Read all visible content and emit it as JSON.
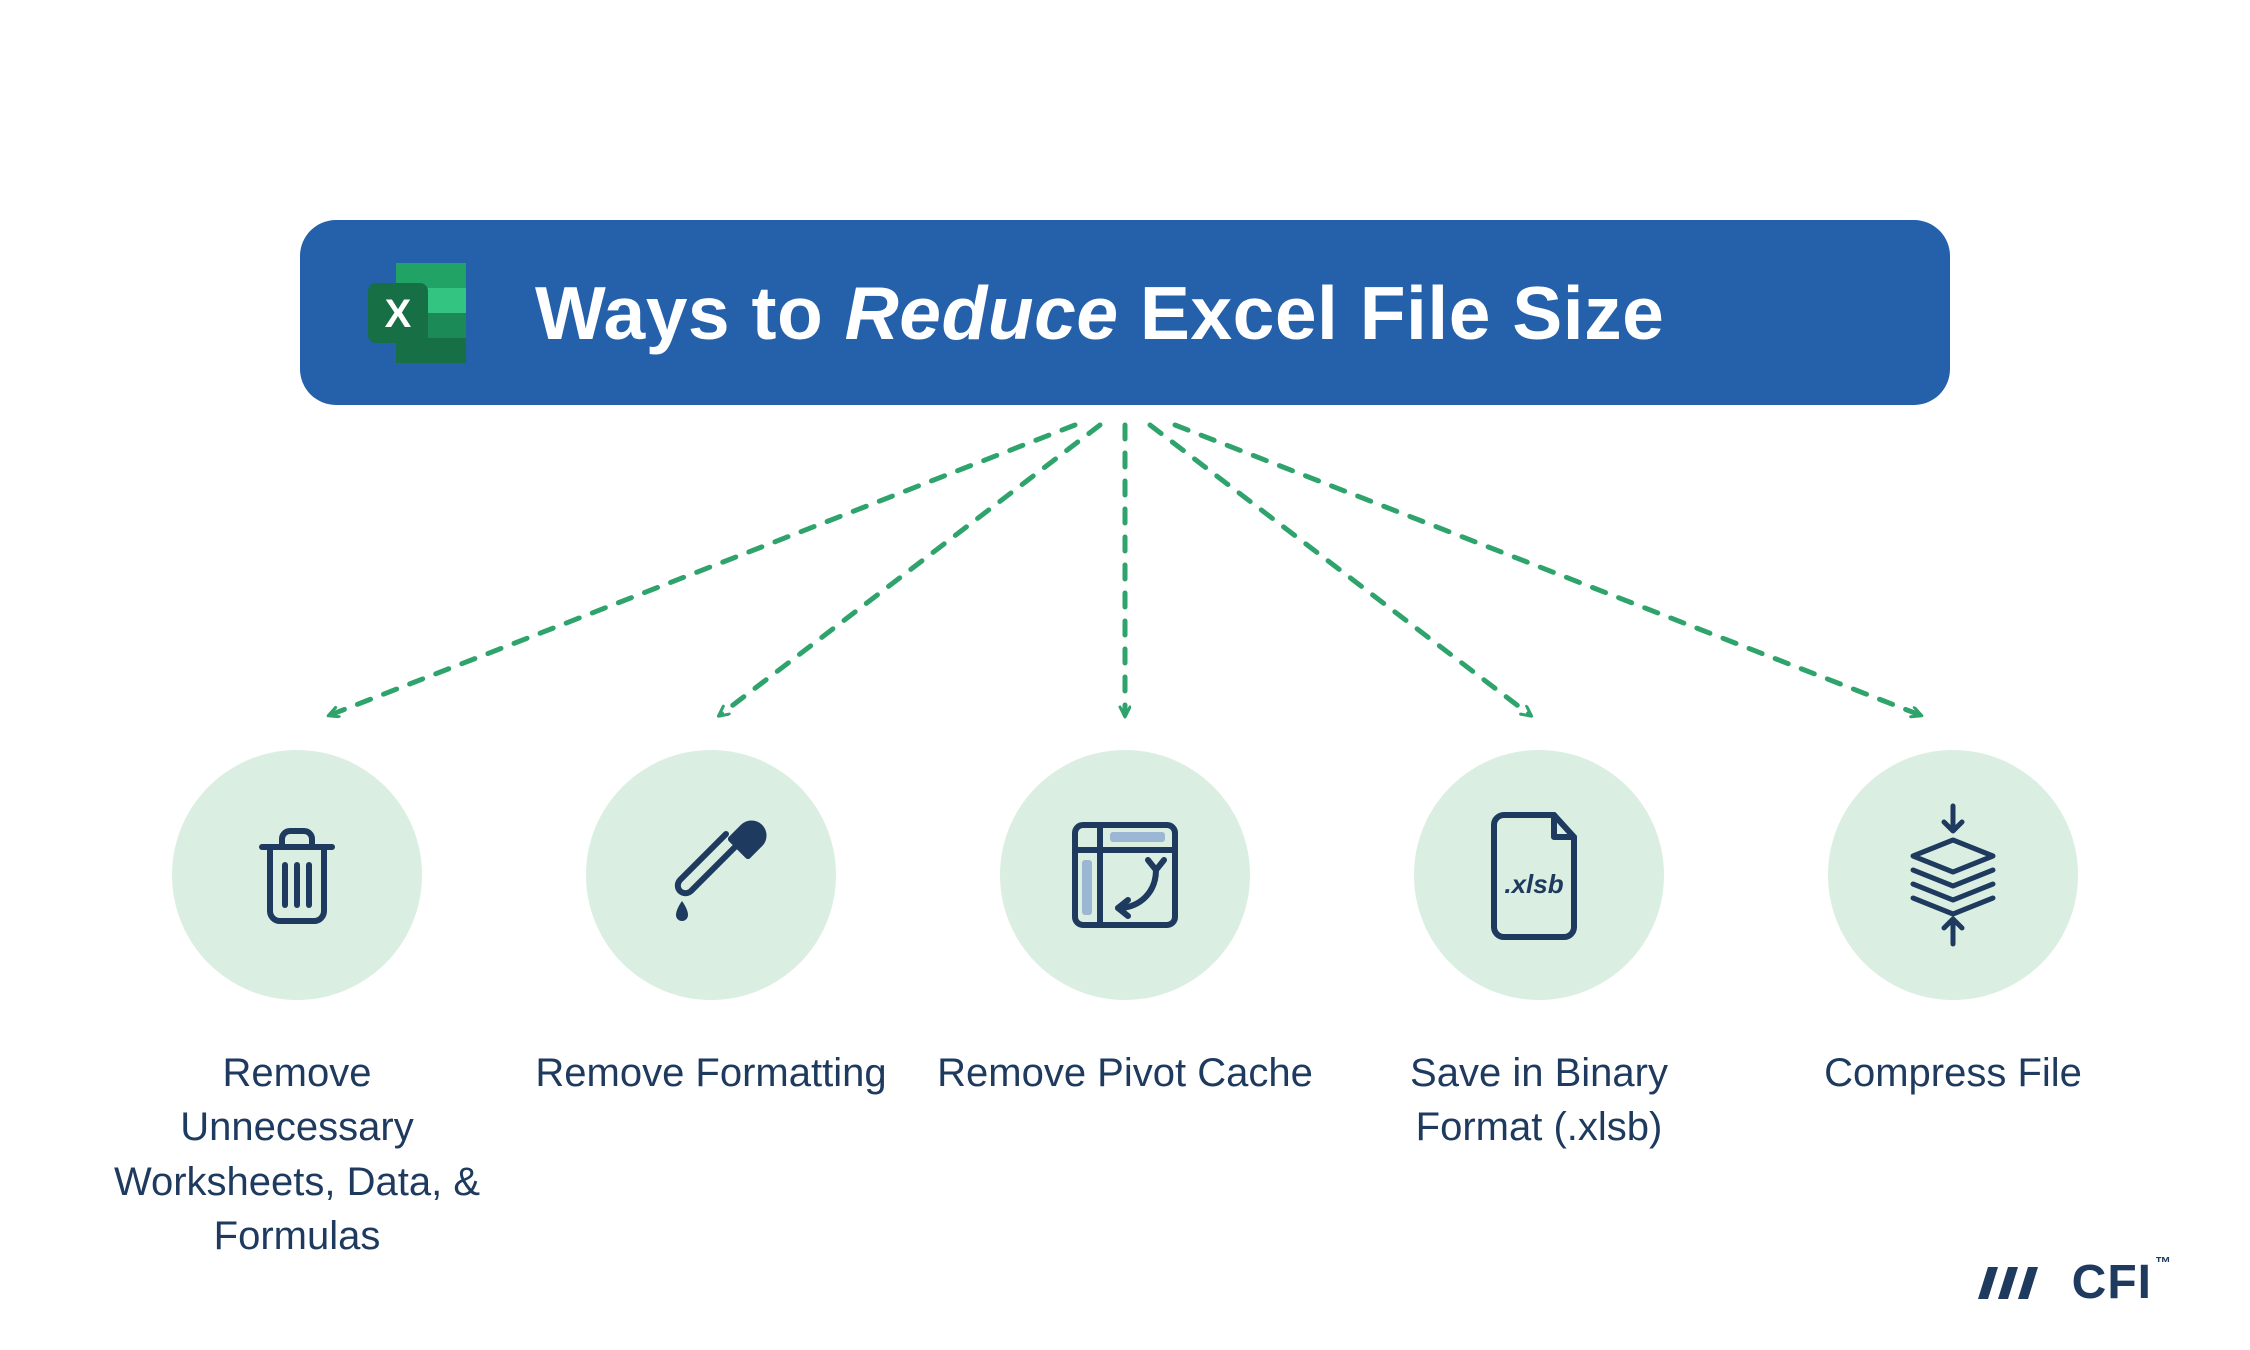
{
  "banner": {
    "title_prefix": "Ways to ",
    "title_emph": "Reduce",
    "title_suffix": " Excel File Size",
    "icon_letter": "X"
  },
  "items": [
    {
      "icon": "trash",
      "label": "Remove Unnecessary Worksheets, Data, & Formulas"
    },
    {
      "icon": "dropper",
      "label": "Remove Formatting"
    },
    {
      "icon": "pivot",
      "label": "Remove Pivot Cache"
    },
    {
      "icon": "xlsb",
      "label": "Save in Binary Format (.xlsb)",
      "file_text": ".xlsb"
    },
    {
      "icon": "compress",
      "label": "Compress File"
    }
  ],
  "logo": {
    "text": "CFI",
    "trademark": "™"
  },
  "colors": {
    "banner_blue": "#2560aa",
    "arrow_green": "#2ea36c",
    "circle_mint": "#daeee2",
    "text_navy": "#1e3a5f"
  }
}
